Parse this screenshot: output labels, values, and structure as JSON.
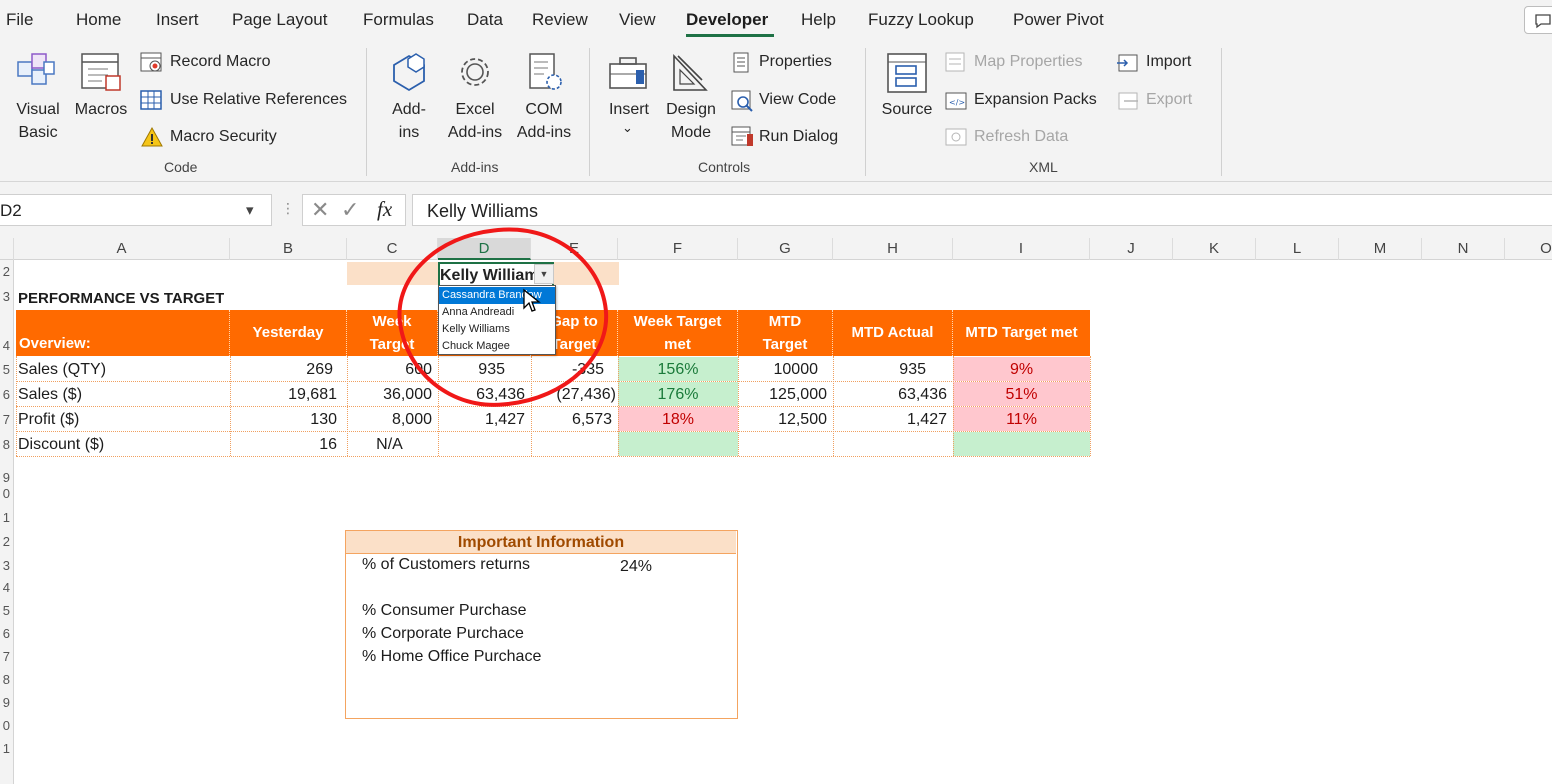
{
  "menu": {
    "tabs": [
      "File",
      "Home",
      "Insert",
      "Page Layout",
      "Formulas",
      "Data",
      "Review",
      "View",
      "Developer",
      "Help",
      "Fuzzy Lookup",
      "Power Pivot"
    ],
    "active_tab": "Developer"
  },
  "ribbon": {
    "code": {
      "visual_basic": [
        "Visual",
        "Basic"
      ],
      "macros": "Macros",
      "record_macro": "Record Macro",
      "relative_refs": "Use Relative References",
      "macro_security": "Macro Security",
      "group_label": "Code"
    },
    "addins": {
      "addins": [
        "Add-",
        "ins"
      ],
      "excel_addins": [
        "Excel",
        "Add-ins"
      ],
      "com_addins": [
        "COM",
        "Add-ins"
      ],
      "group_label": "Add-ins"
    },
    "controls": {
      "insert": "Insert",
      "design_mode": [
        "Design",
        "Mode"
      ],
      "properties": "Properties",
      "view_code": "View Code",
      "run_dialog": "Run Dialog",
      "group_label": "Controls"
    },
    "xml": {
      "source": "Source",
      "map_properties": "Map Properties",
      "expansion_packs": "Expansion Packs",
      "refresh_data": "Refresh Data",
      "import": "Import",
      "export": "Export",
      "group_label": "XML"
    }
  },
  "formula_bar": {
    "name_box": "D2",
    "fx": "fx",
    "content": "Kelly Williams"
  },
  "grid": {
    "columns": [
      "A",
      "B",
      "C",
      "D",
      "E",
      "F",
      "G",
      "H",
      "I",
      "J",
      "K",
      "L",
      "M",
      "N",
      "O"
    ],
    "selected_column": "D",
    "row_numbers": [
      "2",
      "3",
      "4",
      "5",
      "6",
      "7",
      "8",
      "9",
      "0",
      "1",
      "2",
      "3",
      "4",
      "5",
      "6",
      "7",
      "8",
      "9",
      "0",
      "1"
    ]
  },
  "sheet": {
    "selected_name": "Kelly William",
    "title": "PERFORMANCE VS TARGET",
    "header": {
      "overview": "Overview:",
      "yesterday": "Yesterday",
      "week_target": [
        "Week",
        "Target"
      ],
      "gap_to_target": [
        "Gap to",
        "Target"
      ],
      "week_target_met": [
        "Week Target",
        "met"
      ],
      "mtd_target": [
        "MTD",
        "Target"
      ],
      "mtd_actual": "MTD Actual",
      "mtd_target_met": "MTD Target met"
    },
    "rows": [
      {
        "label": "Sales (QTY)",
        "yesterday": "269",
        "week_target": "600",
        "actual": "935",
        "gap": "-335",
        "week_met": "156%",
        "mtd_target": "10000",
        "mtd_actual": "935",
        "mtd_met": "9%"
      },
      {
        "label": "Sales ($)",
        "yesterday": "19,681",
        "week_target": "36,000",
        "actual": "63,436",
        "gap": "(27,436)",
        "week_met": "176%",
        "mtd_target": "125,000",
        "mtd_actual": "63,436",
        "mtd_met": "51%"
      },
      {
        "label": "Profit ($)",
        "yesterday": "130",
        "week_target": "8,000",
        "actual": "1,427",
        "gap": "6,573",
        "week_met": "18%",
        "mtd_target": "12,500",
        "mtd_actual": "1,427",
        "mtd_met": "11%"
      },
      {
        "label": "Discount ($)",
        "yesterday": "16",
        "week_target": "N/A",
        "actual": "",
        "gap": "",
        "week_met": "",
        "mtd_target": "",
        "mtd_actual": "",
        "mtd_met": ""
      }
    ],
    "dropdown_options": [
      "Cassandra Brandow",
      "Anna Andreadi",
      "Kelly Williams",
      "Chuck Magee"
    ],
    "info_box": {
      "title": "Important Information",
      "returns_label": "% of Customers returns",
      "returns_value": "24%",
      "consumer": "% Consumer Purchase",
      "corporate": "% Corporate Purchace",
      "home_office": "% Home Office Purchace"
    }
  },
  "colors": {
    "header_orange": "#ff6a00",
    "good_green": "#c6efce",
    "bad_red": "#ffc7ce",
    "annotation_red": "#f01818",
    "excel_green": "#1e7145"
  }
}
